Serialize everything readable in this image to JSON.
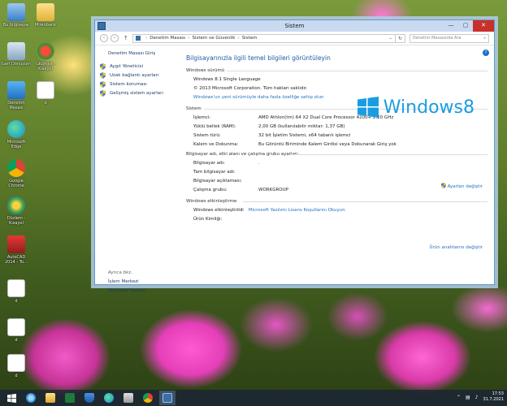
{
  "desktop": {
    "icons": [
      {
        "label": "Bu bilgisayar"
      },
      {
        "label": "Mirenbank"
      },
      {
        "label": "Geri Dönüşüm"
      },
      {
        "label": "Gkümcə - Kısayol"
      },
      {
        "label": "Denetim Masası"
      },
      {
        "label": "d"
      },
      {
        "label": "Microsoft Edge"
      },
      {
        "label": "Google Chrome"
      },
      {
        "label": "Düzlem - Kısayol"
      },
      {
        "label": "AutoCAD 2014 - Tü..."
      },
      {
        "label": "d"
      },
      {
        "label": "d"
      },
      {
        "label": "d"
      }
    ]
  },
  "window": {
    "title": "Sistem",
    "minimize": "—",
    "maximize": "▢",
    "close": "✕",
    "breadcrumb": [
      "Denetim Masası",
      "Sistem ve Güvenlik",
      "Sistem"
    ],
    "search_placeholder": "Denetim Masasında Ara",
    "sidebar": {
      "home": "Denetim Masası Giriş",
      "links": [
        "Aygıt Yöneticisi",
        "Uzak bağlantı ayarları",
        "Sistem koruması",
        "Gelişmiş sistem ayarları"
      ],
      "see_also_title": "Ayrıca bkz.",
      "see_also": [
        "İşlem Merkezi",
        "Windows Update"
      ]
    },
    "main": {
      "heading": "Bilgisayarınızla ilgili temel bilgileri görüntüleyin",
      "edition_title": "Windows sürümü",
      "edition": "Windows 8.1 Single Language",
      "copyright": "© 2013 Microsoft Corporation. Tüm hakları saklıdır.",
      "more_features": "Windows'un yeni sürümüyle daha fazla özelliğe sahip olun",
      "logo_text": "Windows",
      "logo_num": "8",
      "system_title": "Sistem",
      "system_rows": [
        {
          "label": "İşlemci:",
          "value": "AMD Athlon(tm) 64 X2 Dual Core Processor 4200+    2.20 GHz"
        },
        {
          "label": "Yüklü bellek (RAM):",
          "value": "2,00 GB (kullanılabilir miktar: 1,37 GB)"
        },
        {
          "label": "Sistem türü:",
          "value": "32 bit İşletim Sistemi, x64 tabanlı işlemci"
        },
        {
          "label": "Kalem ve Dokunma:",
          "value": "Bu Görüntü Biriminde Kalem Girdisi veya Dokunarak Giriş yok"
        }
      ],
      "computer_title": "Bilgisayar adı, etki alanı ve çalışma grubu ayarları",
      "computer_rows": [
        {
          "label": "Bilgisayar adı:",
          "value": "."
        },
        {
          "label": "Tam bilgisayar adı:",
          "value": ""
        },
        {
          "label": "Bilgisayar açıklaması:",
          "value": ""
        },
        {
          "label": "Çalışma grubu:",
          "value": "WORKGROUP"
        }
      ],
      "change_settings": "Ayarları değiştir",
      "activation_title": "Windows etkinleştirme",
      "activation_label": "Windows etkinleştirildi",
      "license_link": "Microsoft Yazılımı Lisans Koşullarını Okuyun",
      "product_id_label": "Ürün Kimliği:",
      "product_id_value": "",
      "change_key": "Ürün anahtarını değiştir"
    }
  },
  "taskbar": {
    "time": "17:53",
    "date": "31.7.2021",
    "items": [
      "start",
      "ie",
      "explorer",
      "excel",
      "defender",
      "edge",
      "chrome-store",
      "chrome",
      "system"
    ]
  },
  "colors": {
    "accent": "#1e5aa8",
    "link": "#1e6fc4",
    "close": "#c7302b",
    "windows_logo": "#1a9de0"
  }
}
